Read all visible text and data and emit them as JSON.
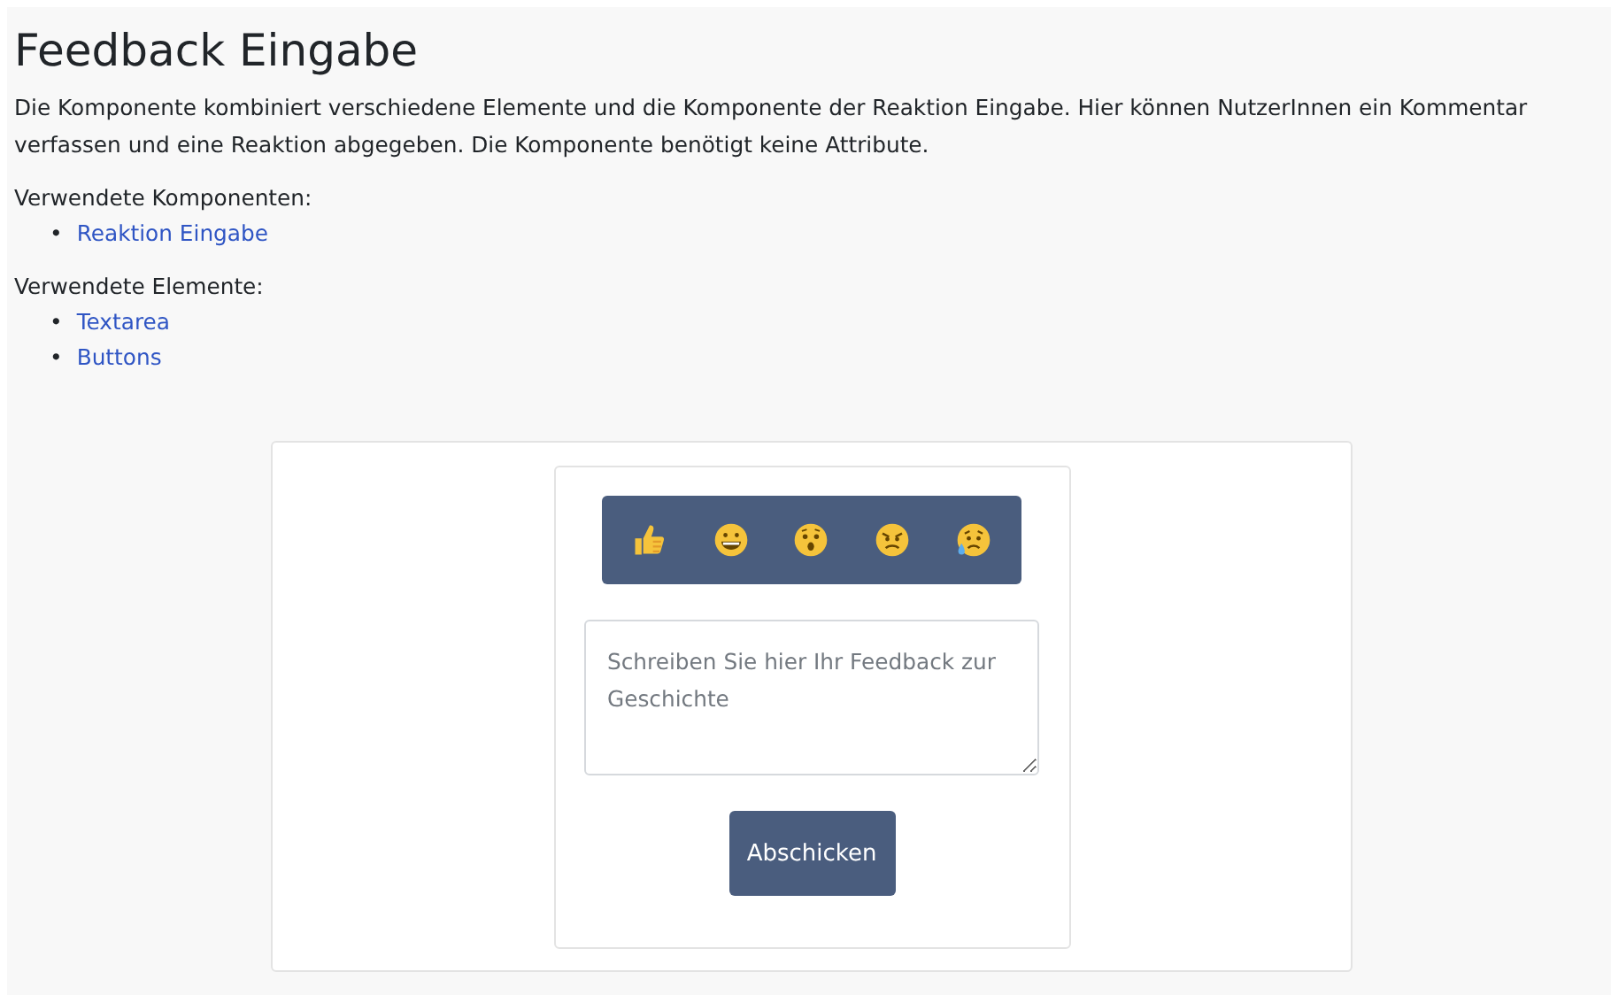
{
  "title": "Feedback Eingabe",
  "description": "Die Komponente kombiniert verschiedene Elemente und die Komponente der Reaktion Eingabe. Hier können NutzerInnen ein Kommentar verfassen und eine Reaktion abgegeben. Die Komponente benötigt keine Attribute.",
  "sections": [
    {
      "heading": "Verwendete Komponenten:",
      "links": [
        {
          "bullet": "•",
          "label": "Reaktion Eingabe"
        }
      ]
    },
    {
      "heading": "Verwendete Elemente:",
      "links": [
        {
          "bullet": "•",
          "label": "Textarea"
        },
        {
          "bullet": "•",
          "label": "Buttons"
        }
      ]
    }
  ],
  "feedback": {
    "placeholder": "Schreiben Sie hier Ihr Feedback zur Geschichte",
    "submit": "Abschicken"
  }
}
